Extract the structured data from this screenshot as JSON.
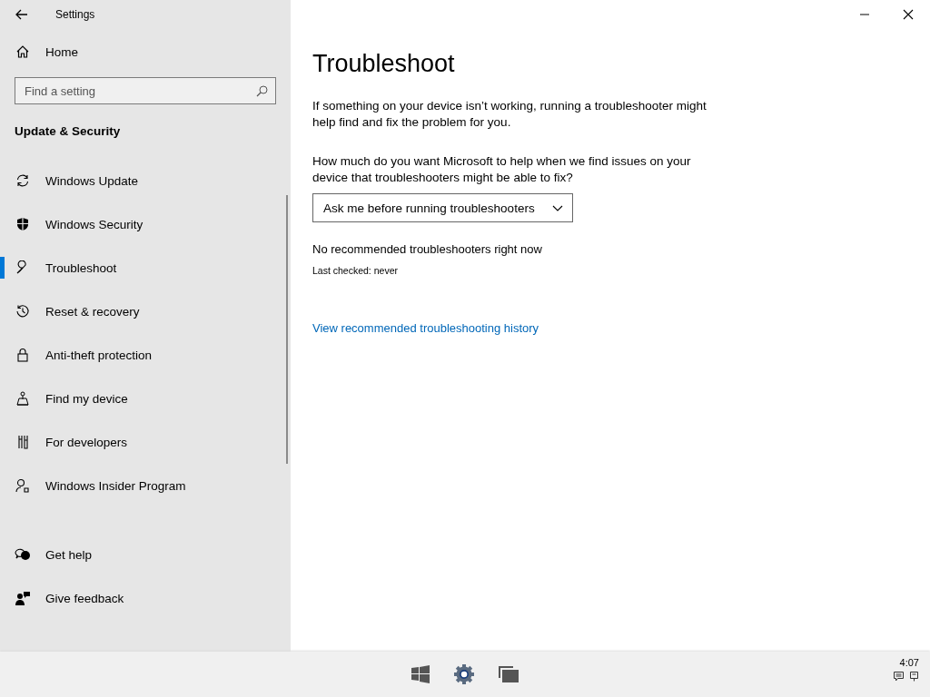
{
  "window": {
    "title": "Settings"
  },
  "sidebar": {
    "home": "Home",
    "search": {
      "placeholder": "Find a setting"
    },
    "section": "Update & Security",
    "items": [
      {
        "label": "Windows Update",
        "selected": false
      },
      {
        "label": "Windows Security",
        "selected": false
      },
      {
        "label": "Troubleshoot",
        "selected": true
      },
      {
        "label": "Reset & recovery",
        "selected": false
      },
      {
        "label": "Anti-theft protection",
        "selected": false
      },
      {
        "label": "Find my device",
        "selected": false
      },
      {
        "label": "For developers",
        "selected": false
      },
      {
        "label": "Windows Insider Program",
        "selected": false
      }
    ],
    "footer_items": [
      {
        "label": "Get help"
      },
      {
        "label": "Give feedback"
      }
    ]
  },
  "main": {
    "title": "Troubleshoot",
    "intro": "If something on your device isn’t working, running a troubleshooter might help find and fix the problem for you.",
    "question": "How much do you want Microsoft to help when we find issues on your device that troubleshooters might be able to fix?",
    "dropdown": {
      "value": "Ask me before running troubleshooters"
    },
    "status": "No recommended troubleshooters right now",
    "last_checked": "Last checked: never",
    "link": "View recommended troubleshooting history"
  },
  "taskbar": {
    "clock": "4:07"
  }
}
